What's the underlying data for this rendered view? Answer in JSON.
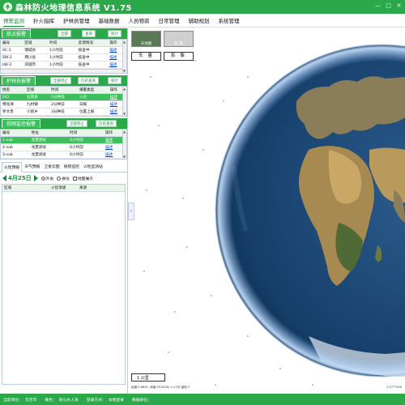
{
  "app": {
    "title": "森林防火地理信息系统 V1.75"
  },
  "menu": [
    {
      "label": "预警监测",
      "active": true
    },
    {
      "label": "扑火指挥"
    },
    {
      "label": "护林员管理"
    },
    {
      "label": "基础数据"
    },
    {
      "label": "人员物资"
    },
    {
      "label": "日常管理"
    },
    {
      "label": "辅助规划"
    },
    {
      "label": "系统管理"
    }
  ],
  "hotspot": {
    "tab": "热点报警",
    "btn_all": "全部",
    "btn_query": "查询",
    "btn_stats": "统计",
    "columns": [
      "编号",
      "区域",
      "时间",
      "反馈情况",
      "操作"
    ],
    "rows": [
      [
        "SC-1",
        "瑞城县",
        "1小时前",
        "核查中",
        "描述"
      ],
      [
        "SW-2",
        "两川县",
        "1小时前",
        "核查中",
        "描述"
      ],
      [
        "LW-3",
        "凤城市",
        "1小时前",
        "核查中",
        "描述"
      ]
    ]
  },
  "ranger": {
    "tab": "护林员报警",
    "btn_stop_all": "全部停止",
    "btn_history": "历史查询",
    "btn_stats": "统计",
    "columns": [
      "姓名",
      "区域",
      "时间",
      "报警类型",
      "操作"
    ],
    "rows": [
      [
        "EIO",
        "石景县",
        "1分钟前",
        "火点",
        "描述"
      ],
      [
        "傅兆清",
        "九村镇",
        "2分钟前",
        "日报",
        "描述"
      ],
      [
        "罗文贵",
        "小岗乡",
        "3分钟前",
        "位置上报",
        "描述"
      ]
    ]
  },
  "video": {
    "tab": "视频监控报警",
    "btn_stop_all": "全部停止",
    "btn_history": "历史查询",
    "columns": [
      "编号",
      "地址",
      "时间",
      "操作"
    ],
    "rows": [
      [
        "1-sub",
        "龙慧测试",
        "6小时前",
        "描述"
      ],
      [
        "2-sub",
        "龙慧测试",
        "6小时前",
        "描述"
      ],
      [
        "3-sub",
        "龙慧测试",
        "6小时前",
        "描述"
      ]
    ]
  },
  "fire": {
    "tabs": [
      "火险预报",
      "天气预报",
      "卫星云图",
      "视频监控",
      "火险监测站"
    ],
    "date": "4月25日",
    "radio_outer": "外省",
    "radio_county": "县份",
    "check_map": "地图展示",
    "columns": [
      "区域",
      "火险等级",
      "来源"
    ]
  },
  "map": {
    "layer1": "天地图",
    "layer2": "影 像",
    "btn_vector": "矢 量",
    "btn_image": "影 像",
    "scale": "1 公里",
    "coords_left": "经度:0.6891, 纬度:29.8158, 1:10万 级别:7",
    "coords_right": "1:277°000"
  },
  "status": {
    "org_label": "当前单位：",
    "org": "东吉市",
    "role_label": "角色：",
    "role": "防火办人员",
    "login_label": "登录方式：",
    "login": "本地登录",
    "region_label": "数据单位：",
    "region": ""
  },
  "colors": {
    "primary": "#2aa84a",
    "selected": "#3cbf5c",
    "link": "#0044cc"
  }
}
